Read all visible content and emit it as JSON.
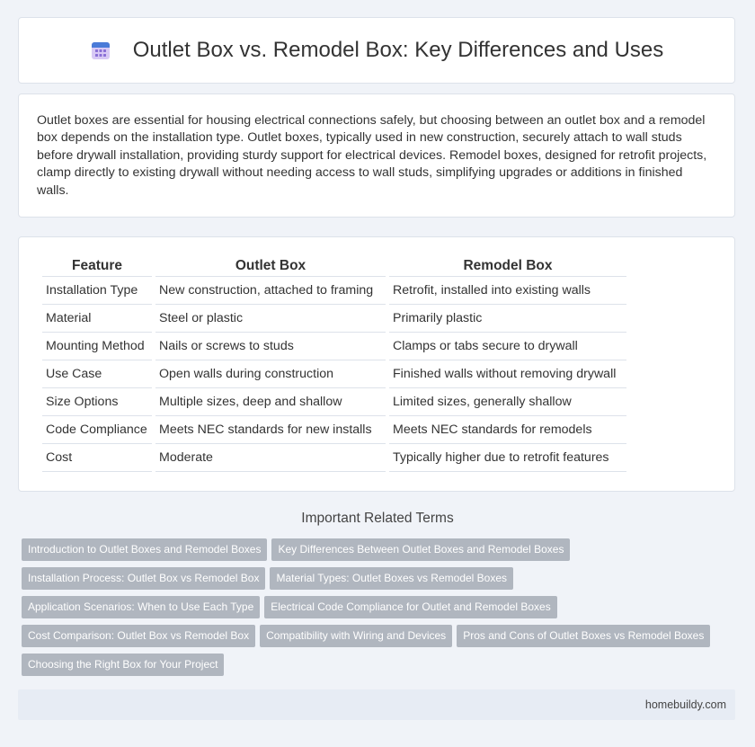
{
  "header": {
    "title": "Outlet Box vs. Remodel Box: Key Differences and Uses",
    "icon": "calendar-icon"
  },
  "intro": {
    "text": "Outlet boxes are essential for housing electrical connections safely, but choosing between an outlet box and a remodel box depends on the installation type. Outlet boxes, typically used in new construction, securely attach to wall studs before drywall installation, providing sturdy support for electrical devices. Remodel boxes, designed for retrofit projects, clamp directly to existing drywall without needing access to wall studs, simplifying upgrades or additions in finished walls."
  },
  "table": {
    "headers": [
      "Feature",
      "Outlet Box",
      "Remodel Box"
    ],
    "rows": [
      [
        "Installation Type",
        "New construction, attached to framing",
        "Retrofit, installed into existing walls"
      ],
      [
        "Material",
        "Steel or plastic",
        "Primarily plastic"
      ],
      [
        "Mounting Method",
        "Nails or screws to studs",
        "Clamps or tabs secure to drywall"
      ],
      [
        "Use Case",
        "Open walls during construction",
        "Finished walls without removing drywall"
      ],
      [
        "Size Options",
        "Multiple sizes, deep and shallow",
        "Limited sizes, generally shallow"
      ],
      [
        "Code Compliance",
        "Meets NEC standards for new installs",
        "Meets NEC standards for remodels"
      ],
      [
        "Cost",
        "Moderate",
        "Typically higher due to retrofit features"
      ]
    ]
  },
  "related": {
    "heading": "Important Related Terms",
    "tags": [
      "Introduction to Outlet Boxes and Remodel Boxes",
      "Key Differences Between Outlet Boxes and Remodel Boxes",
      "Installation Process: Outlet Box vs Remodel Box",
      "Material Types: Outlet Boxes vs Remodel Boxes",
      "Application Scenarios: When to Use Each Type",
      "Electrical Code Compliance for Outlet and Remodel Boxes",
      "Cost Comparison: Outlet Box vs Remodel Box",
      "Compatibility with Wiring and Devices",
      "Pros and Cons of Outlet Boxes vs Remodel Boxes",
      "Choosing the Right Box for Your Project"
    ]
  },
  "footer": {
    "site": "homebuildy.com"
  },
  "colors": {
    "background": "#f0f3f8",
    "tag": "#b0b6bf",
    "icon_top": "#4a7bd8",
    "icon_body": "#c9b6f0"
  }
}
